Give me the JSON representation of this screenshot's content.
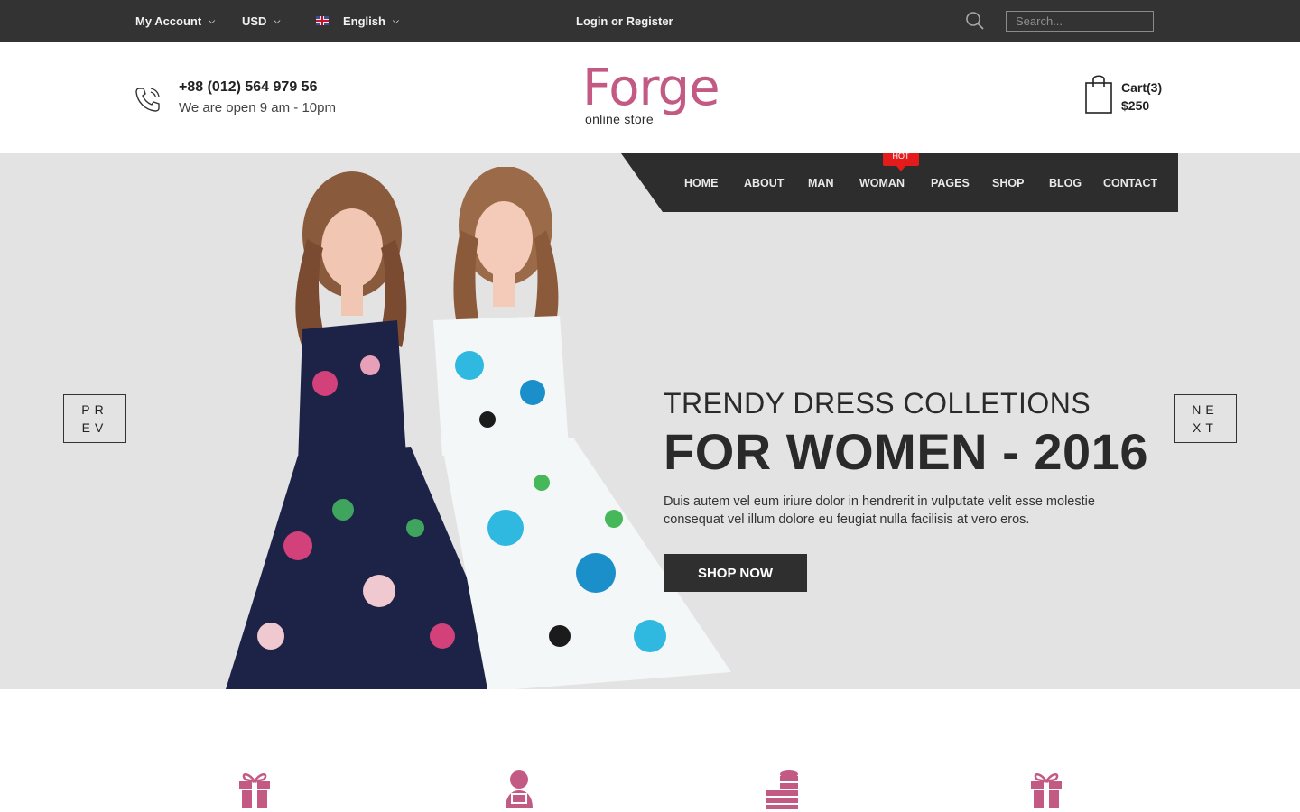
{
  "topbar": {
    "account": "My Account",
    "currency": "USD",
    "language": "English",
    "login": "Login or Register",
    "search_placeholder": "Search..."
  },
  "header": {
    "phone": "+88 (012) 564 979 56",
    "hours": "We are open 9 am - 10pm",
    "logo_word": "Forge",
    "logo_sub": "online store",
    "cart_label": "Cart(3)",
    "cart_total": "$250"
  },
  "nav": {
    "items": [
      "HOME",
      "ABOUT",
      "MAN",
      "WOMAN",
      "PAGES",
      "SHOP",
      "BLOG",
      "CONTACT"
    ],
    "hot_badge": "HOT"
  },
  "hero": {
    "subtitle": "TRENDY DRESS COLLETIONS",
    "title": "FOR WOMEN - 2016",
    "text": "Duis autem vel eum iriure dolor in hendrerit in vulputate velit esse molestie consequat vel illum dolore eu feugiat nulla facilisis at vero eros.",
    "button": "SHOP NOW",
    "prev": "PREV",
    "next": "NEXT"
  },
  "features": {
    "icons": [
      "gift-icon",
      "support-agent-icon",
      "coins-icon",
      "gift-icon"
    ]
  },
  "colors": {
    "brand": "#c25a83",
    "dark": "#333333",
    "hero_bg": "#e3e3e3",
    "hot": "#e41b1b"
  }
}
